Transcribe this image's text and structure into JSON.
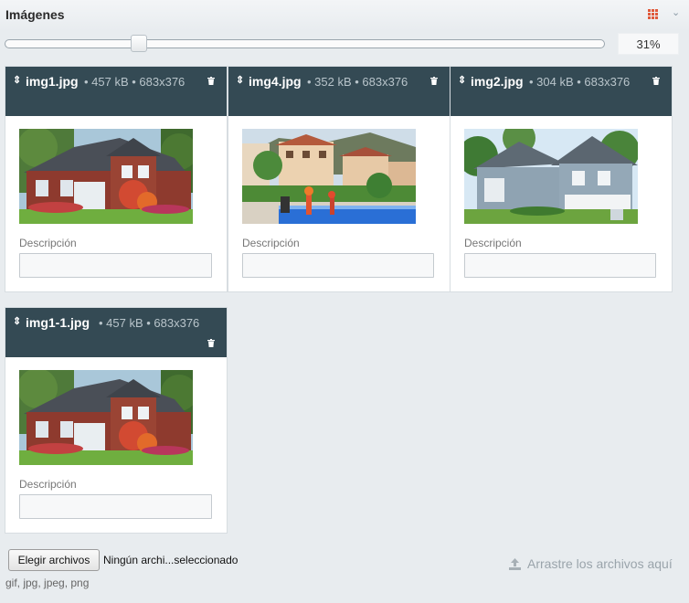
{
  "panel": {
    "title": "Imágenes"
  },
  "toolbar": {
    "grid_icon": "grid-icon",
    "collapse_icon": "chevron-down-icon"
  },
  "zoom": {
    "value_label": "31%",
    "level": 0.31
  },
  "images": [
    {
      "name": "img1.jpg",
      "meta": "• 457 kB • 683x376",
      "desc_label": "Descripción",
      "desc_value": "",
      "scene": "brick-house"
    },
    {
      "name": "img4.jpg",
      "meta": "• 352 kB • 683x376",
      "desc_label": "Descripción",
      "desc_value": "",
      "scene": "villa-pool"
    },
    {
      "name": "img2.jpg",
      "meta": "• 304 kB • 683x376",
      "desc_label": "Descripción",
      "desc_value": "",
      "scene": "blue-house"
    },
    {
      "name": "img1-1.jpg",
      "meta": "• 457 kB • 683x376",
      "desc_label": "Descripción",
      "desc_value": "",
      "scene": "brick-house"
    }
  ],
  "upload": {
    "button_label": "Elegir archivos",
    "status": "Ningún archi...seleccionado",
    "drop_hint": "Arrastre los archivos aquí",
    "formats": "gif, jpg, jpeg, png"
  },
  "colors": {
    "card_header": "#344a54",
    "accent": "#e0593a",
    "background": "#e8ecef"
  }
}
